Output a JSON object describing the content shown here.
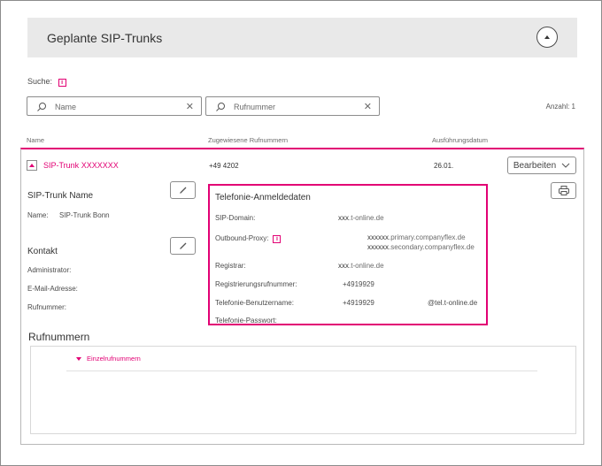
{
  "header": {
    "title": "Geplante SIP-Trunks"
  },
  "search": {
    "label": "Suche:",
    "name_placeholder": "Name",
    "number_placeholder": "Rufnummer",
    "count": "Anzahl: 1"
  },
  "columns": {
    "name": "Name",
    "numbers": "Zugewiesene Rufnummern",
    "date": "Ausführungsdatum"
  },
  "trunk_row": {
    "name_prefix": "SIP-Trunk ",
    "name_suffix": "XXXXXXX",
    "number": "+49 4202",
    "date": "26.01.",
    "edit_button": "Bearbeiten"
  },
  "sip_trunk_name": {
    "title": "SIP-Trunk Name",
    "name_label": "Name:",
    "name_value": "SIP-Trunk Bonn"
  },
  "contact": {
    "title": "Kontakt",
    "admin_label": "Administrator:",
    "email_label": "E-Mail-Adresse:",
    "phone_label": "Rufnummer:"
  },
  "telephony": {
    "title": "Telefonie-Anmeldedaten",
    "sip_domain_label": "SIP-Domain:",
    "sip_domain_prefix": "xxx",
    "sip_domain_suffix": ".t-online.de",
    "outbound_label": "Outbound-Proxy:",
    "outbound_1_prefix": "xxxxxx",
    "outbound_1_suffix": ".primary.companyflex.de",
    "outbound_2_prefix": "xxxxxx",
    "outbound_2_suffix": ".secondary.companyflex.de",
    "registrar_label": "Registrar:",
    "registrar_prefix": "xxx",
    "registrar_suffix": ".t-online.de",
    "reg_number_label": "Registrierungsrufnummer:",
    "reg_number_value": "+4919929",
    "username_label": "Telefonie-Benutzername:",
    "username_value": "+4919929",
    "username_domain": "@tel.t-online.de",
    "password_label": "Telefonie-Passwort:"
  },
  "rufnummern": {
    "title": "Rufnummern",
    "single_numbers": "Einzelrufnummern"
  },
  "colors": {
    "accent": "#e20074",
    "header_bg": "#e9e9e9"
  }
}
